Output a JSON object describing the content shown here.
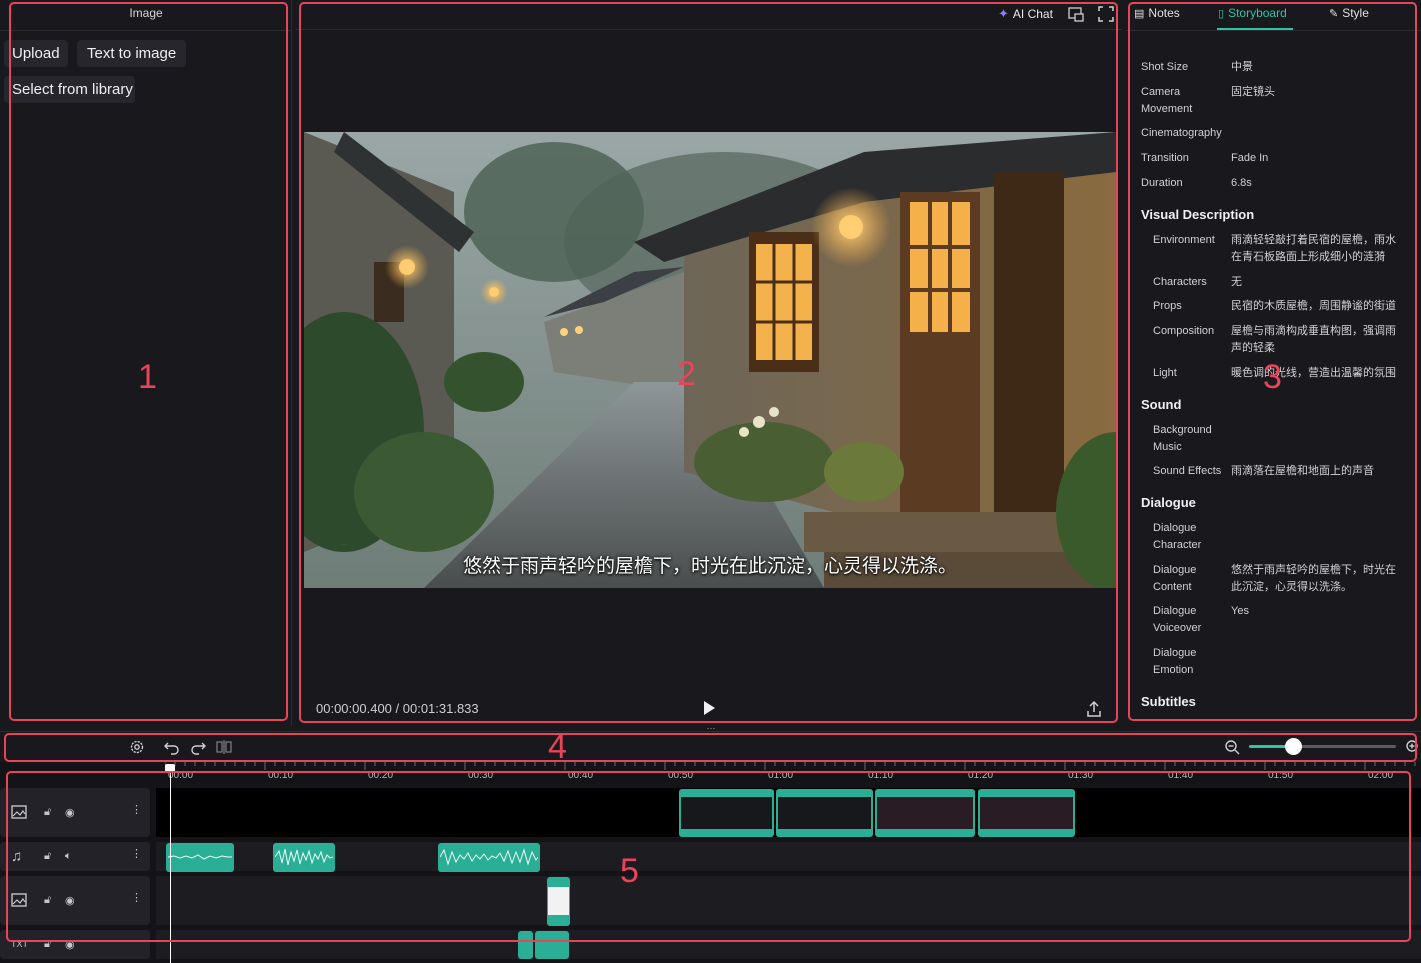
{
  "left_panel": {
    "title": "Image",
    "buttons": {
      "upload": "Upload",
      "text_to_image": "Text to image",
      "select_from_library": "Select from library"
    }
  },
  "preview": {
    "ai_chat": "AI Chat",
    "subtitle": "悠然于雨声轻吟的屋檐下，时光在此沉淀，心灵得以洗涤。",
    "timecode": "00:00:00.400 / 00:01:31.833"
  },
  "right_panel": {
    "tabs": {
      "notes": "Notes",
      "storyboard": "Storyboard",
      "style": "Style"
    },
    "shot": {
      "shot_size_label": "Shot Size",
      "shot_size": "中景",
      "camera_movement_label": "Camera Movement",
      "camera_movement": "固定镜头",
      "cinematography_label": "Cinematography",
      "transition_label": "Transition",
      "transition": "Fade In",
      "duration_label": "Duration",
      "duration": "6.8s"
    },
    "visual": {
      "title": "Visual Description",
      "environment_label": "Environment",
      "environment": "雨滴轻轻敲打着民宿的屋檐，雨水在青石板路面上形成细小的涟漪",
      "characters_label": "Characters",
      "characters": "无",
      "props_label": "Props",
      "props": "民宿的木质屋檐，周围静谧的街道",
      "composition_label": "Composition",
      "composition": "屋檐与雨滴构成垂直构图，强调雨声的轻柔",
      "light_label": "Light",
      "light": "暖色调的光线，营造出温馨的氛围"
    },
    "sound": {
      "title": "Sound",
      "bgm_label": "Background Music",
      "sfx_label": "Sound Effects",
      "sfx": "雨滴落在屋檐和地面上的声音"
    },
    "dialogue": {
      "title": "Dialogue",
      "character_label": "Dialogue Character",
      "content_label": "Dialogue Content",
      "content": "悠然于雨声轻吟的屋檐下，时光在此沉淀，心灵得以洗涤。",
      "voiceover_label": "Dialogue Voiceover",
      "voiceover": "Yes",
      "emotion_label": "Dialogue Emotion"
    },
    "subtitles_title": "Subtitles"
  },
  "timeline": {
    "ruler_labels": [
      "00:00",
      "00:10",
      "00:20",
      "00:30",
      "00:40",
      "00:50",
      "01:00",
      "01:10",
      "01:20",
      "01:30",
      "01:40",
      "01:50",
      "02:00"
    ],
    "zoom_level": 0.3,
    "track_txt_label": "TXT"
  },
  "annotations": [
    "1",
    "2",
    "3",
    "4",
    "5"
  ],
  "colors": {
    "accent": "#2ec4a6",
    "annotation": "#e8455a",
    "clip": "#2aae95"
  }
}
